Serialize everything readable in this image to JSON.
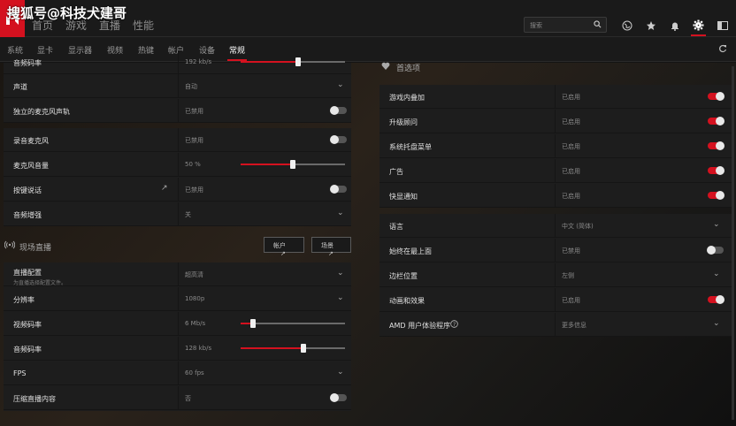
{
  "watermark": "搜狐号@科技犬建哥",
  "topnav": [
    "首页",
    "游戏",
    "直播",
    "性能"
  ],
  "search": {
    "placeholder": "搜索"
  },
  "top_icons": [
    "globe-icon",
    "star-icon",
    "bell-icon",
    "gear-icon",
    "window-icon"
  ],
  "tabs": [
    "系统",
    "显卡",
    "显示器",
    "视频",
    "热键",
    "帐户",
    "设备",
    "常规"
  ],
  "left_top_panel": {
    "partial_label": "音频码率",
    "partial_value": "192 kb/s",
    "partial_level": 0.55,
    "channel": {
      "label": "声道",
      "value": "自动"
    },
    "mic_track": {
      "label": "独立的麦克风声轨",
      "value": "已禁用",
      "on": false
    }
  },
  "left_mid_panel": {
    "record_mic": {
      "label": "录音麦克风",
      "value": "已禁用",
      "on": false
    },
    "mic_volume": {
      "label": "麦克风音量",
      "value": "50 %",
      "level": 0.5
    },
    "push_to_talk": {
      "label": "按键说话",
      "value": "已禁用",
      "on": false
    },
    "audio_boost": {
      "label": "音频增强",
      "value": "关"
    }
  },
  "live": {
    "title": "现场直播",
    "account_button": "帐户",
    "scene_button": "场景"
  },
  "left_bottom_panel": {
    "stream_config": {
      "label": "直播配置",
      "sublabel": "为直播选择配置文件。",
      "value": "超高清"
    },
    "resolution": {
      "label": "分辨率",
      "value": "1080p"
    },
    "video_bitrate": {
      "label": "视频码率",
      "value": "6 Mb/s",
      "level": 0.12
    },
    "audio_bitrate": {
      "label": "音频码率",
      "value": "128 kb/s",
      "level": 0.6
    },
    "fps": {
      "label": "FPS",
      "value": "60 fps"
    },
    "compress": {
      "label": "压缩直播内容",
      "value": "否",
      "on": false
    }
  },
  "favorites": {
    "title": "首选项"
  },
  "right_top_panel": [
    {
      "label": "游戏内叠加",
      "value": "已启用",
      "on": true
    },
    {
      "label": "升级顾问",
      "value": "已启用",
      "on": true
    },
    {
      "label": "系统托盘菜单",
      "value": "已启用",
      "on": true
    },
    {
      "label": "广告",
      "value": "已启用",
      "on": true
    },
    {
      "label": "快显通知",
      "value": "已启用",
      "on": true
    }
  ],
  "right_bottom_panel": {
    "language": {
      "label": "语言",
      "value": "中文 (简体)"
    },
    "always_on_top": {
      "label": "始终在最上面",
      "value": "已禁用",
      "on": false
    },
    "sidebar_pos": {
      "label": "边栏位置",
      "value": "左侧"
    },
    "animation": {
      "label": "动画和效果",
      "value": "已启用",
      "on": true
    },
    "amd_program": {
      "label": "AMD 用户体验程序",
      "value": "更多信息"
    }
  },
  "colors": {
    "accent": "#d4111f",
    "panel": "#1d1d1d",
    "background": "#141414"
  }
}
